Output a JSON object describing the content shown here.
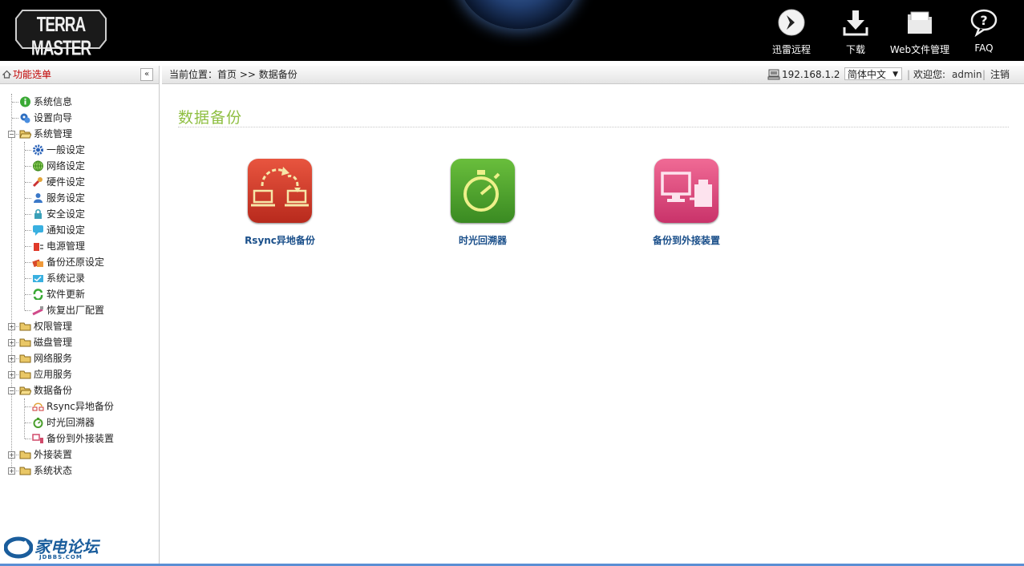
{
  "brand": {
    "logo_text": "TERRA MASTER"
  },
  "top_nav": [
    {
      "label": "迅雷远程",
      "icon": "thunder-remote-icon"
    },
    {
      "label": "下载",
      "icon": "download-icon"
    },
    {
      "label": "Web文件管理",
      "icon": "folder-icon"
    },
    {
      "label": "FAQ",
      "icon": "help-icon"
    }
  ],
  "sidebar": {
    "title": "功能选单",
    "collapse_glyph": "«",
    "tree": [
      {
        "label": "系统信息",
        "level": 0,
        "icon": "info-icon"
      },
      {
        "label": "设置向导",
        "level": 0,
        "icon": "wizard-icon"
      },
      {
        "label": "系统管理",
        "level": 0,
        "icon": "folder-open-icon",
        "expanded": true
      },
      {
        "label": "一般设定",
        "level": 1,
        "icon": "gear-icon"
      },
      {
        "label": "网络设定",
        "level": 1,
        "icon": "globe-icon"
      },
      {
        "label": "硬件设定",
        "level": 1,
        "icon": "wrench-icon"
      },
      {
        "label": "服务设定",
        "level": 1,
        "icon": "service-icon"
      },
      {
        "label": "安全设定",
        "level": 1,
        "icon": "lock-icon"
      },
      {
        "label": "通知设定",
        "level": 1,
        "icon": "chat-icon"
      },
      {
        "label": "电源管理",
        "level": 1,
        "icon": "power-icon"
      },
      {
        "label": "备份还原设定",
        "level": 1,
        "icon": "backup-restore-icon"
      },
      {
        "label": "系统记录",
        "level": 1,
        "icon": "log-icon"
      },
      {
        "label": "软件更新",
        "level": 1,
        "icon": "refresh-icon"
      },
      {
        "label": "恢复出厂配置",
        "level": 1,
        "icon": "factory-reset-icon"
      },
      {
        "label": "权限管理",
        "level": 0,
        "icon": "folder-icon",
        "expanded": false
      },
      {
        "label": "磁盘管理",
        "level": 0,
        "icon": "folder-icon",
        "expanded": false
      },
      {
        "label": "网络服务",
        "level": 0,
        "icon": "folder-icon",
        "expanded": false
      },
      {
        "label": "应用服务",
        "level": 0,
        "icon": "folder-icon",
        "expanded": false
      },
      {
        "label": "数据备份",
        "level": 0,
        "icon": "folder-open-icon",
        "expanded": true
      },
      {
        "label": "Rsync异地备份",
        "level": 1,
        "icon": "rsync-icon"
      },
      {
        "label": "时光回溯器",
        "level": 1,
        "icon": "timer-icon"
      },
      {
        "label": "备份到外接装置",
        "level": 1,
        "icon": "external-device-icon"
      },
      {
        "label": "外接装置",
        "level": 0,
        "icon": "folder-icon",
        "expanded": false
      },
      {
        "label": "系统状态",
        "level": 0,
        "icon": "folder-icon",
        "expanded": false
      }
    ],
    "bbs_logo": {
      "main": "家电论坛",
      "sub": "JDBBS.COM"
    }
  },
  "breadcrumb": {
    "text": "当前位置：首页 >> 数据备份"
  },
  "userbar": {
    "ip": "192.168.1.2",
    "language": "简体中文",
    "sep1": "|",
    "welcome": "欢迎您:",
    "username": "admin",
    "sep2": "|",
    "logout": "注销"
  },
  "content": {
    "title": "数据备份",
    "apps": [
      {
        "label": "Rsync异地备份",
        "icon": "rsync-app-icon",
        "color": "#d2392b"
      },
      {
        "label": "时光回溯器",
        "icon": "time-machine-app-icon",
        "color": "#4a9e2c"
      },
      {
        "label": "备份到外接装置",
        "icon": "external-backup-app-icon",
        "color": "#e04a7c"
      }
    ]
  }
}
